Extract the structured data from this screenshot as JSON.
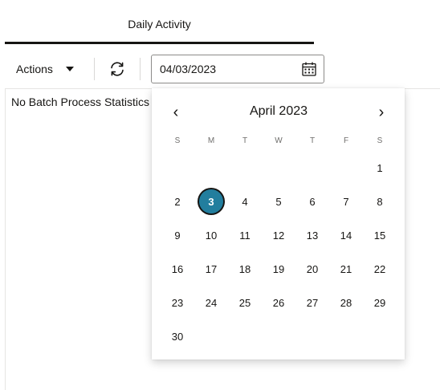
{
  "tab": {
    "title": "Daily Activity"
  },
  "toolbar": {
    "actions_label": "Actions",
    "date_value": "04/03/2023"
  },
  "content": {
    "empty_message": "No Batch Process Statistics"
  },
  "datepicker": {
    "month_label": "April 2023",
    "prev_glyph": "‹",
    "next_glyph": "›",
    "weekday_headers": [
      "S",
      "M",
      "T",
      "W",
      "T",
      "F",
      "S"
    ],
    "selected_day": "3",
    "weeks": [
      [
        "",
        "",
        "",
        "",
        "",
        "",
        "1"
      ],
      [
        "2",
        "3",
        "4",
        "5",
        "6",
        "7",
        "8"
      ],
      [
        "9",
        "10",
        "11",
        "12",
        "13",
        "14",
        "15"
      ],
      [
        "16",
        "17",
        "18",
        "19",
        "20",
        "21",
        "22"
      ],
      [
        "23",
        "24",
        "25",
        "26",
        "27",
        "28",
        "29"
      ],
      [
        "30",
        "",
        "",
        "",
        "",
        "",
        ""
      ]
    ]
  },
  "colors": {
    "selected_day_bg": "#227e9e",
    "text": "#161513"
  }
}
